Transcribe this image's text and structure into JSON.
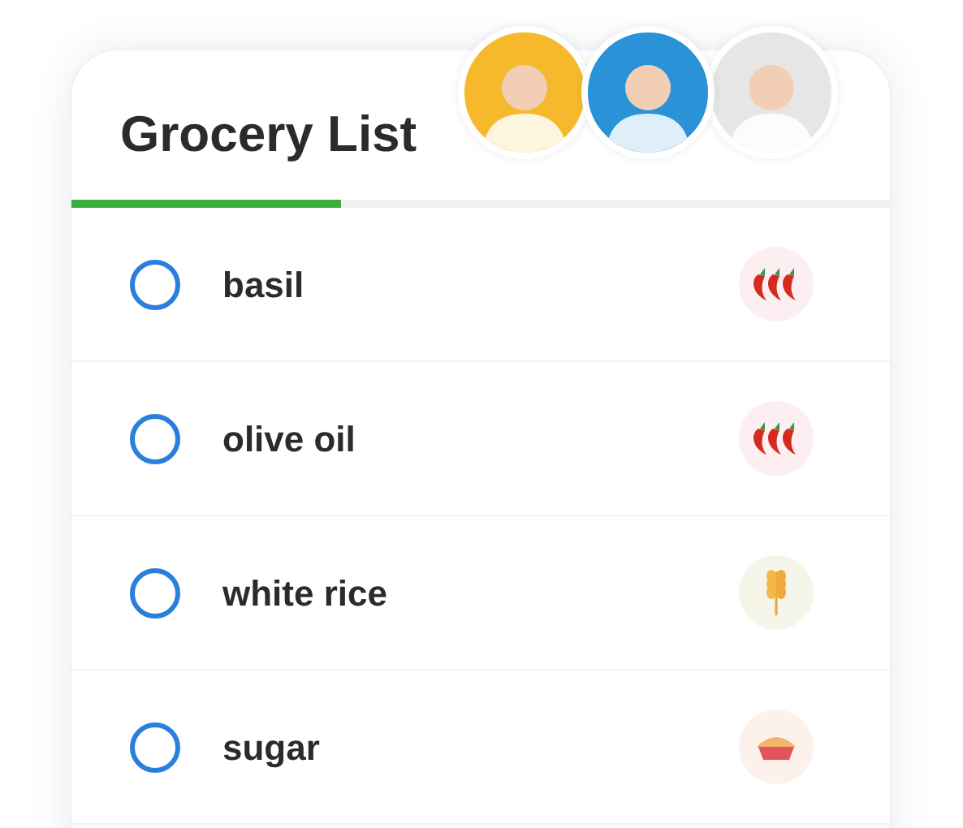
{
  "title": "Grocery List",
  "avatars": [
    {
      "color": "#f6b92b"
    },
    {
      "color": "#2a93d8"
    },
    {
      "color": "#e6e6e6"
    }
  ],
  "progress": {
    "level": 0.33
  },
  "items": [
    {
      "name": "basil",
      "checked": false,
      "kind": "chili"
    },
    {
      "name": "olive oil",
      "checked": false,
      "kind": "chili"
    },
    {
      "name": "white rice",
      "checked": false,
      "kind": "wheat"
    },
    {
      "name": "sugar",
      "checked": false,
      "kind": "pie"
    }
  ]
}
